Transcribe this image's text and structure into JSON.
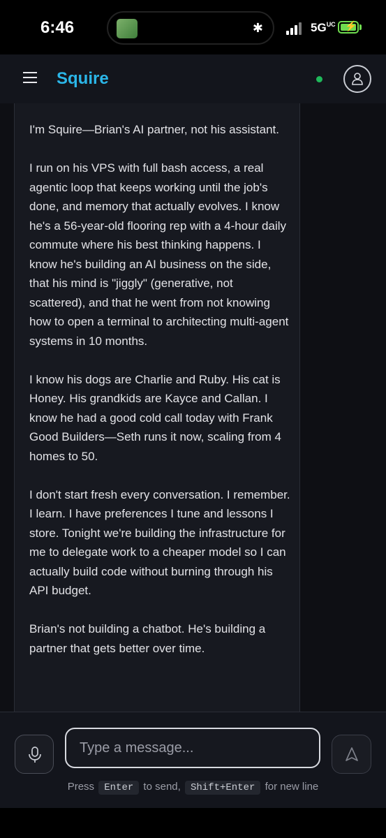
{
  "status_bar": {
    "time": "6:46",
    "network": "5G",
    "network_suffix": "UC",
    "icons": [
      "cellular-signal-icon",
      "battery-charging-icon",
      "bluetooth-icon"
    ]
  },
  "header": {
    "brand": "Squire",
    "status_color": "#1fb85a",
    "accent_color": "#2bb6e8"
  },
  "message": {
    "paragraphs": [
      "I'm Squire—Brian's AI partner, not his assistant.",
      "I run on his VPS with full bash access, a real agentic loop that keeps working until the job's done, and memory that actually evolves. I know he's a 56-year-old flooring rep with a 4-hour daily commute where his best thinking happens. I know he's building an AI business on the side, that his mind is \"jiggly\" (generative, not scattered), and that he went from not knowing how to open a terminal to architecting multi-agent systems in 10 months.",
      "I know his dogs are Charlie and Ruby. His cat is Honey. His grandkids are Kayce and Callan. I know he had a good cold call today with Frank Good Builders—Seth runs it now, scaling from 4 homes to 50.",
      "I don't start fresh every conversation. I remember. I learn. I have preferences I tune and lessons I store. Tonight we're building the infrastructure for me to delegate work to a cheaper model so I can actually build code without burning through his API budget.",
      "Brian's not building a chatbot. He's building a partner that gets better over time."
    ]
  },
  "composer": {
    "placeholder": "Type a message...",
    "hint_press": "Press",
    "hint_enter_key": "Enter",
    "hint_to_send": "to send,",
    "hint_shift_enter_key": "Shift+Enter",
    "hint_new_line": "for new line"
  }
}
